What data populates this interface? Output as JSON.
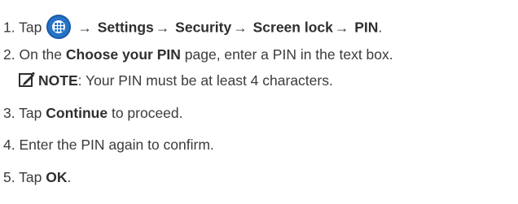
{
  "steps": [
    {
      "number": "1.",
      "tap": "Tap",
      "path": [
        "Settings",
        "Security",
        "Screen lock",
        "PIN"
      ],
      "end": "."
    },
    {
      "number": "2.",
      "pre": "On the",
      "page_name": "Choose your PIN",
      "post": "page, enter a PIN in the text box.",
      "note_label": "NOTE",
      "note_text": ": Your PIN must be at least 4 characters."
    },
    {
      "number": "3.",
      "pre": "Tap",
      "button": "Continue",
      "post": "to proceed."
    },
    {
      "number": "4.",
      "text": "Enter the PIN again to confirm."
    },
    {
      "number": "5.",
      "pre": "Tap",
      "button": "OK",
      "end": "."
    }
  ],
  "icons": {
    "apps": "apps-grid-icon",
    "note": "note-pencil-icon"
  },
  "arrow": "→",
  "colors": {
    "text": "#3b3b3b",
    "bold": "#2f2f2f",
    "icon_blue": "#2673c8"
  }
}
